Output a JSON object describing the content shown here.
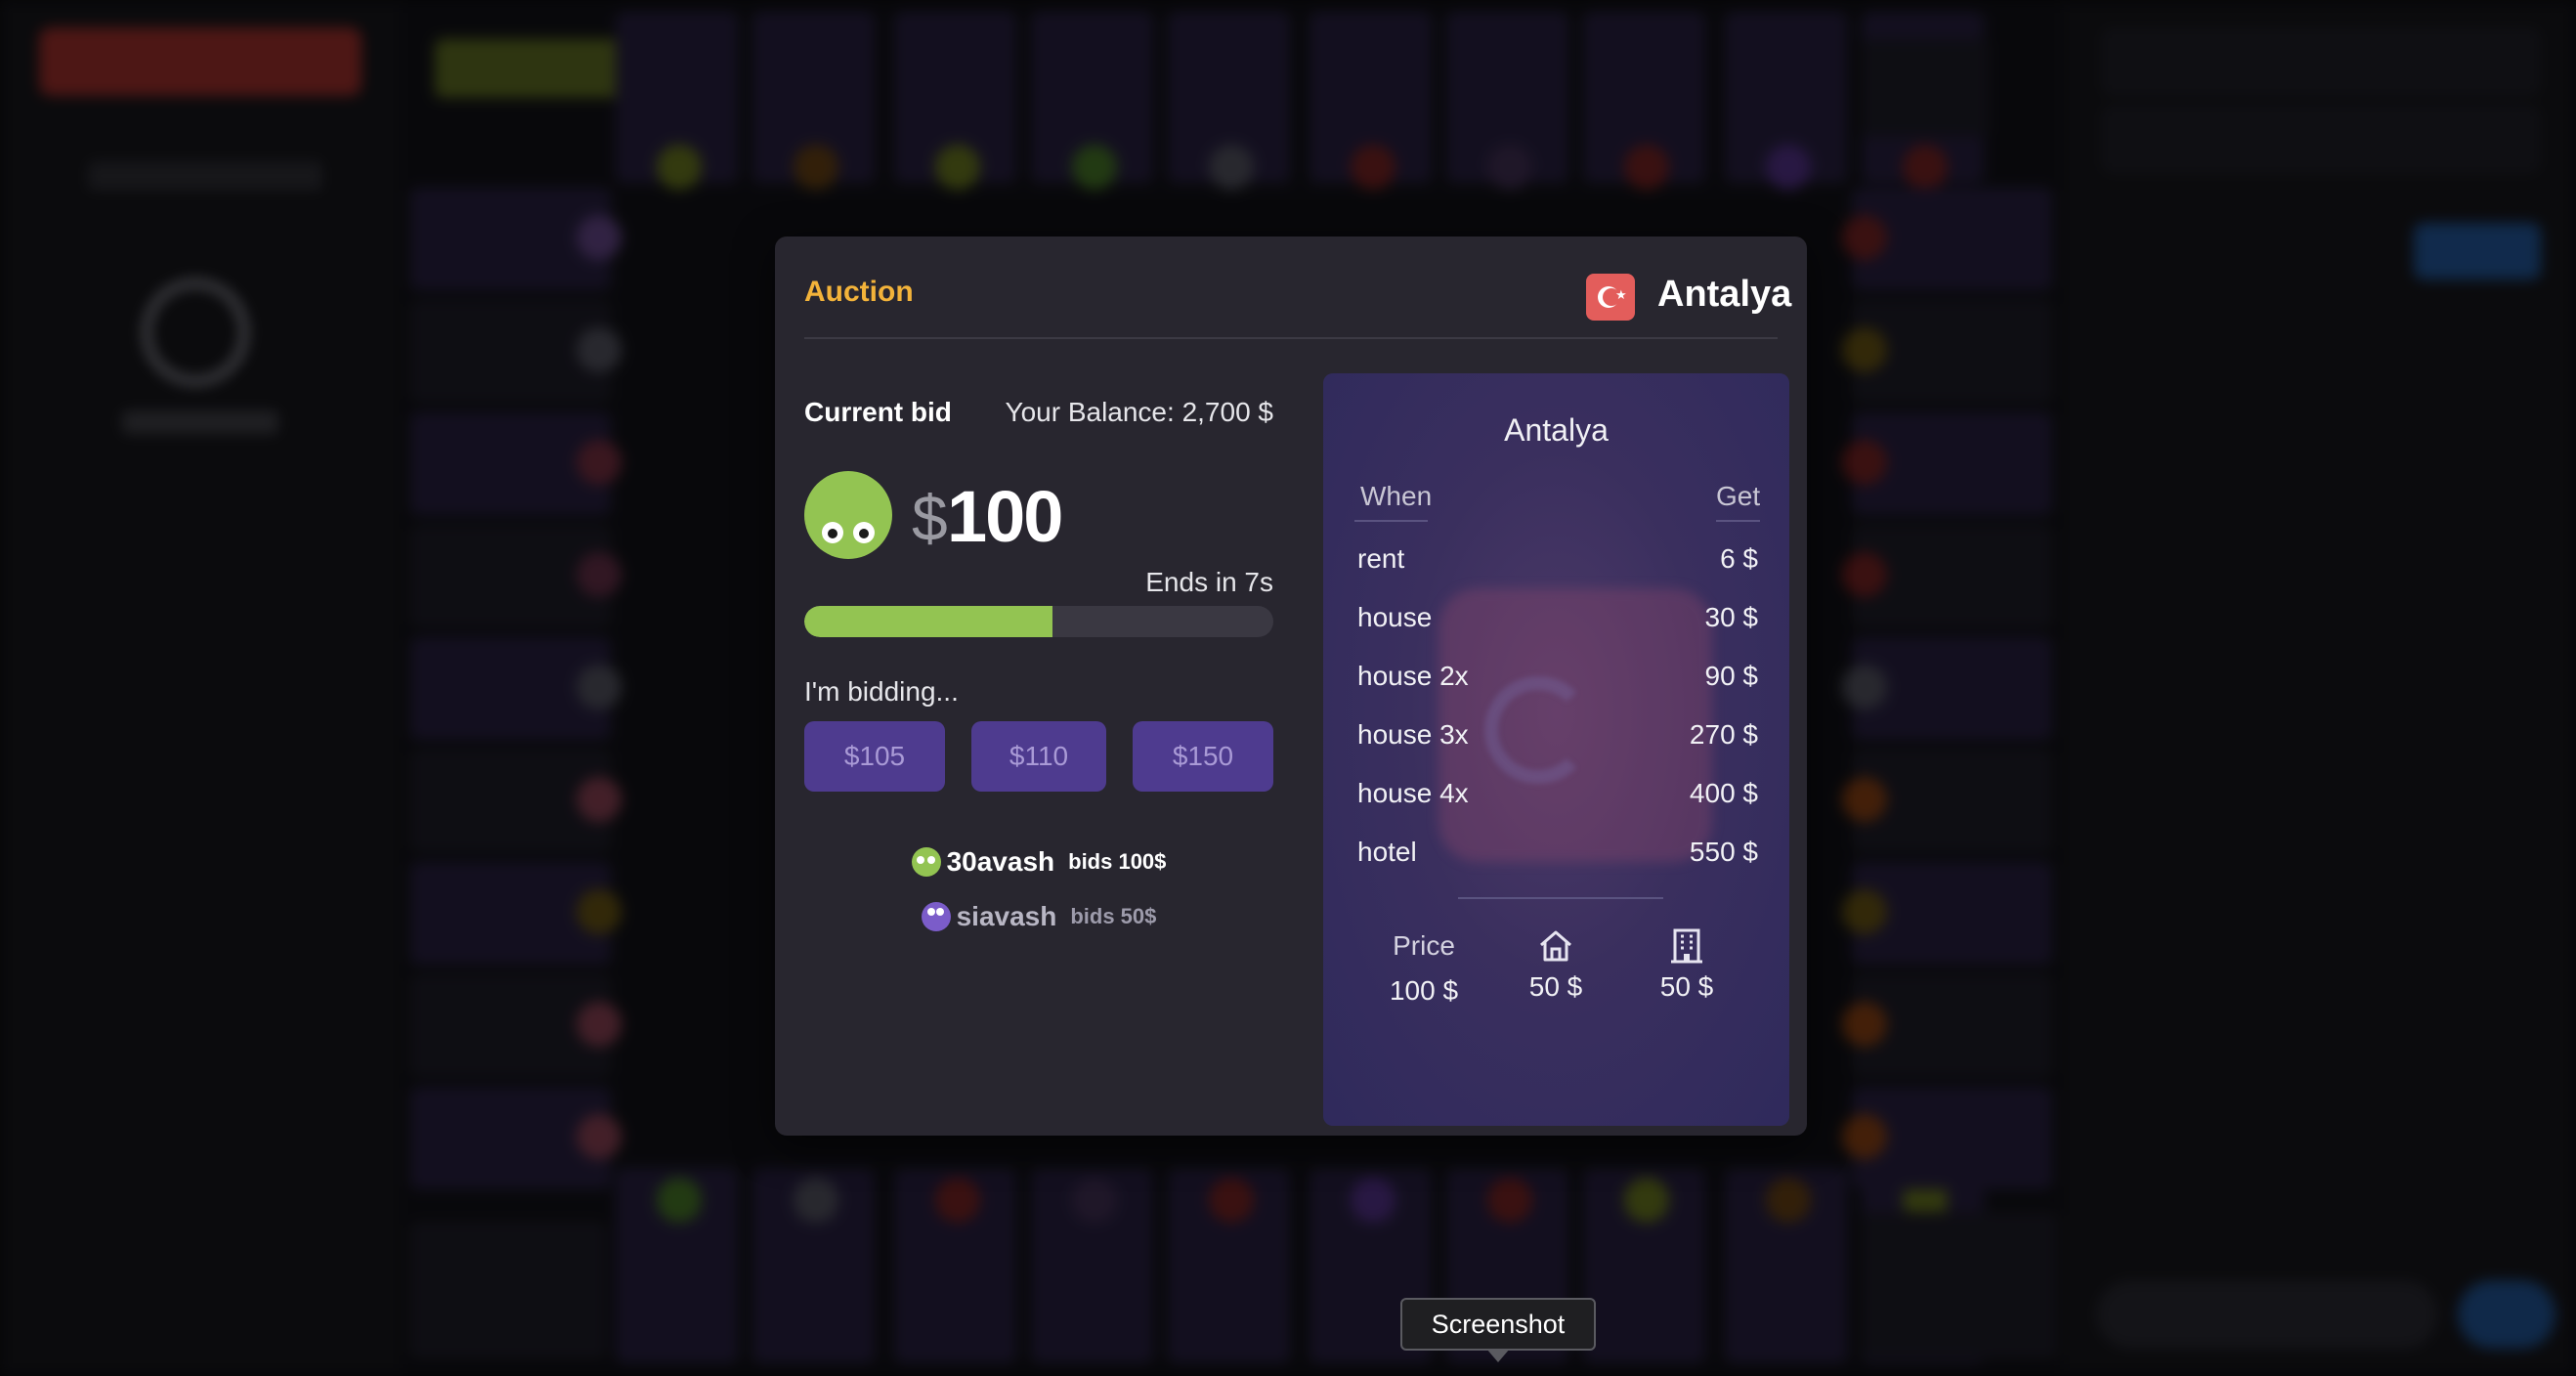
{
  "auction": {
    "title": "Auction",
    "city": "Antalya",
    "current_bid_label": "Current bid",
    "balance_text": "Your Balance: 2,700 $",
    "currency_symbol": "$",
    "current_bid": "100",
    "ends_in": "Ends in 7s",
    "progress_fraction": 0.53,
    "bidding_label": "I'm bidding...",
    "bid_options": [
      "$105",
      "$110",
      "$150"
    ],
    "bid_log": [
      {
        "name": "30avash",
        "action": "bids 100$",
        "avatar_color": "#93c452",
        "name_color": "#ffffff",
        "action_color": "#ffffff"
      },
      {
        "name": "siavash",
        "action": "bids 50$",
        "avatar_color": "#7b5cc9",
        "name_color": "#b8b6c4",
        "action_color": "#9d9bab"
      }
    ],
    "colors": {
      "accent": "#f3b33a",
      "progress": "#93c452",
      "bid_button": "#4e3b8f",
      "flag_red": "#e35d5b"
    }
  },
  "card": {
    "title": "Antalya",
    "when_label": "When",
    "get_label": "Get",
    "rows": [
      {
        "when": "rent",
        "get": "6 $"
      },
      {
        "when": "house",
        "get": "30 $"
      },
      {
        "when": "house 2x",
        "get": "90 $"
      },
      {
        "when": "house 3x",
        "get": "270 $"
      },
      {
        "when": "house 4x",
        "get": "400 $"
      },
      {
        "when": "hotel",
        "get": "550 $"
      }
    ],
    "price_label": "Price",
    "price_value": "100 $",
    "house_cost": "50 $",
    "hotel_cost": "50 $",
    "icons": [
      "house-icon",
      "building-icon"
    ]
  },
  "tooltip": {
    "text": "Screenshot"
  }
}
